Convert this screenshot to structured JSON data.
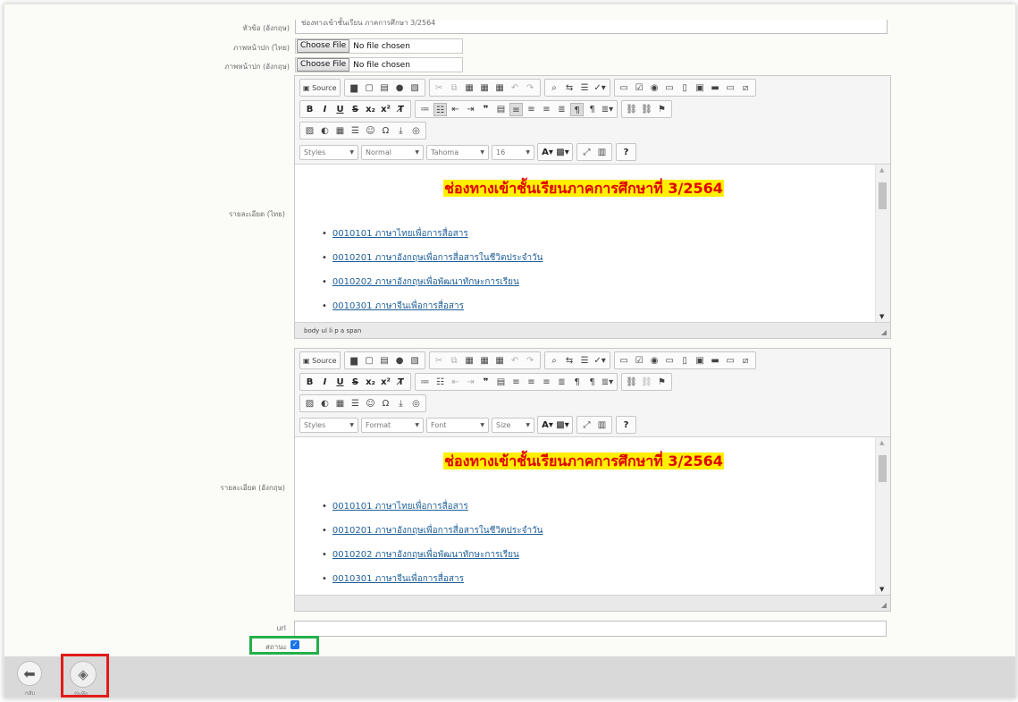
{
  "form": {
    "title_en_label": "หัวข้อ (อังกฤษ)",
    "title_en_value": "ช่องทางเข้าชั้นเรียน ภาคการศึกษา 3/2564",
    "cover_th_label": "ภาพหน้าปก (ไทย)",
    "cover_en_label": "ภาพหน้าปก (อังกฤษ)",
    "choose_file": "Choose File",
    "no_file": "No file chosen",
    "detail_th_label": "รายละเอียด (ไทย)",
    "detail_en_label": "รายละเอียด (อังกฤษ)",
    "url_label": "url",
    "url_value": "",
    "status_label": "สถานะ",
    "status_checked": true
  },
  "editor_th": {
    "source_label": "Source",
    "combos": [
      "Styles",
      "Normal",
      "Tahoma",
      "16"
    ],
    "heading": "ช่องทางเข้าชั้นเรียนภาคการศึกษาที่ 3/2564",
    "items": [
      "0010101 ภาษาไทยเพื่อการสื่อสาร",
      "0010201 ภาษาอังกฤษเพื่อการสื่อสารในชีวิตประจำวัน",
      "0010202 ภาษาอังกฤษเพื่อพัฒนาทักษะการเรียน",
      "0010301 ภาษาจีนเพื่อการสื่อสาร"
    ],
    "path": "body  ul  li  p  a  span"
  },
  "editor_en": {
    "source_label": "Source",
    "combos": [
      "Styles",
      "Format",
      "Font",
      "Size"
    ],
    "heading": "ช่องทางเข้าชั้นเรียนภาคการศึกษาที่ 3/2564",
    "items": [
      "0010101 ภาษาไทยเพื่อการสื่อสาร",
      "0010201 ภาษาอังกฤษเพื่อการสื่อสารในชีวิตประจำวัน",
      "0010202 ภาษาอังกฤษเพื่อพัฒนาทักษะการเรียน",
      "0010301 ภาษาจีนเพื่อการสื่อสาร"
    ],
    "path": ""
  },
  "actions": {
    "back_label": "กลับ",
    "save_label": "บันทึก"
  },
  "colors": {
    "highlight_box_save": "#e21b1b",
    "highlight_box_status": "#22b04a",
    "heading_text": "#e00000",
    "heading_bg": "#ffef00"
  }
}
